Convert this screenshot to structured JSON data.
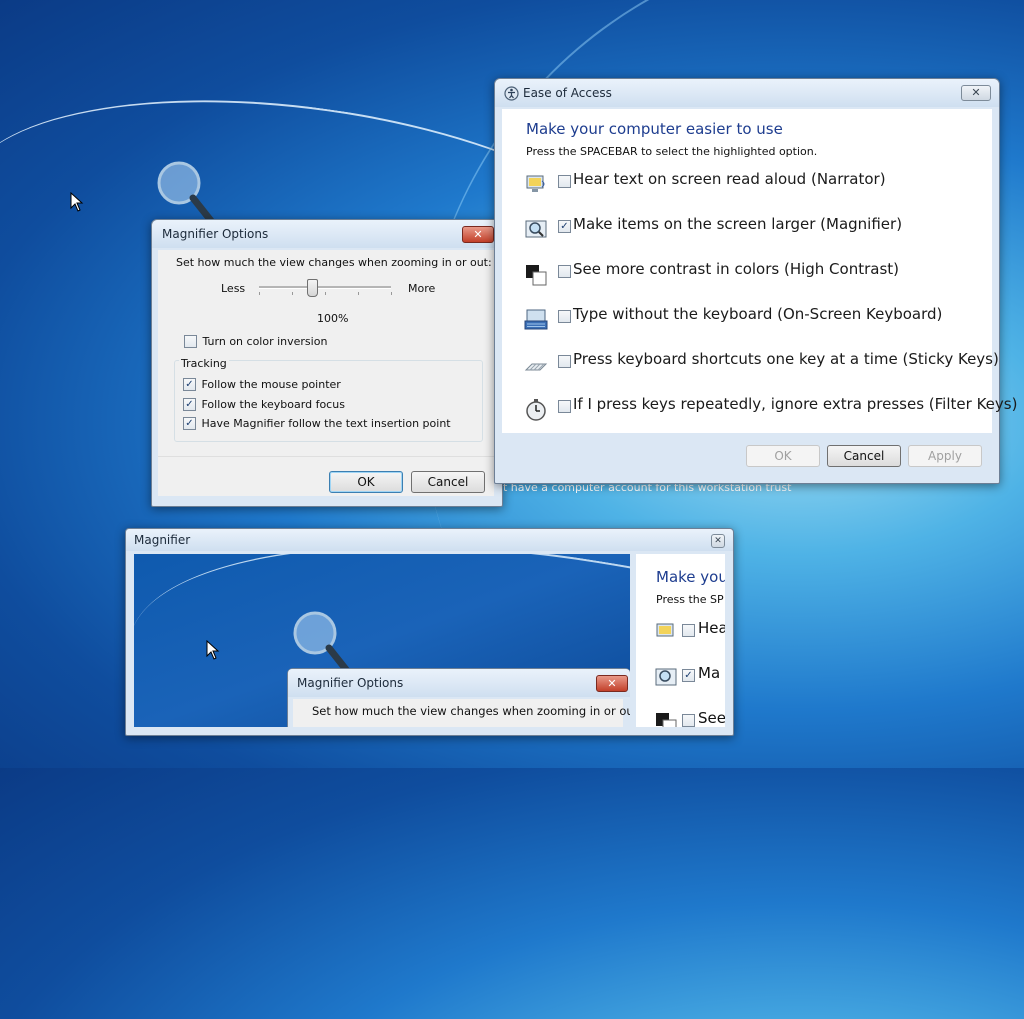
{
  "background_text": "t have a computer account for this workstation trust",
  "magnifier_options": {
    "title": "Magnifier Options",
    "instruction": "Set how much the view changes when zooming in or out:",
    "less_label": "Less",
    "more_label": "More",
    "zoom_value": "100%",
    "slider_fraction": 0.4,
    "color_inversion": {
      "label": "Turn on color inversion",
      "checked": false
    },
    "tracking": {
      "label": "Tracking",
      "options": [
        {
          "label": "Follow the mouse pointer",
          "checked": true
        },
        {
          "label": "Follow the keyboard focus",
          "checked": true
        },
        {
          "label": "Have Magnifier follow the text insertion point",
          "checked": true
        }
      ]
    },
    "ok_label": "OK",
    "cancel_label": "Cancel",
    "close_symbol": "✕"
  },
  "ease_of_access": {
    "title": "Ease of Access",
    "heading": "Make your computer easier to use",
    "subheading": "Press the SPACEBAR to select the highlighted option.",
    "options": [
      {
        "label": "Hear text on screen read aloud (Narrator)",
        "checked": false,
        "icon": "narrator-icon"
      },
      {
        "label": "Make items on the screen larger (Magnifier)",
        "checked": true,
        "icon": "magnifier-icon"
      },
      {
        "label": "See more contrast in colors (High Contrast)",
        "checked": false,
        "icon": "high-contrast-icon"
      },
      {
        "label": "Type without the keyboard (On-Screen Keyboard)",
        "checked": false,
        "icon": "on-screen-keyboard-icon"
      },
      {
        "label": "Press keyboard shortcuts one key at a time (Sticky Keys)",
        "checked": false,
        "icon": "sticky-keys-icon"
      },
      {
        "label": "If I press keys repeatedly, ignore extra presses (Filter Keys)",
        "checked": false,
        "icon": "filter-keys-icon"
      }
    ],
    "ok_label": "OK",
    "cancel_label": "Cancel",
    "apply_label": "Apply",
    "close_symbol": "✕"
  },
  "magnifier_window": {
    "title": "Magnifier",
    "close_symbol": "✕",
    "magnified": {
      "dialog_title": "Magnifier Options",
      "dialog_instruction": "Set how much the view changes when zooming in or out:",
      "ease_heading_partial": "Make you",
      "ease_sub_partial": "Press the SP",
      "row1_partial": "Hea",
      "row2_partial": "Ma",
      "row3_partial": "See",
      "close_symbol": "✕"
    }
  }
}
